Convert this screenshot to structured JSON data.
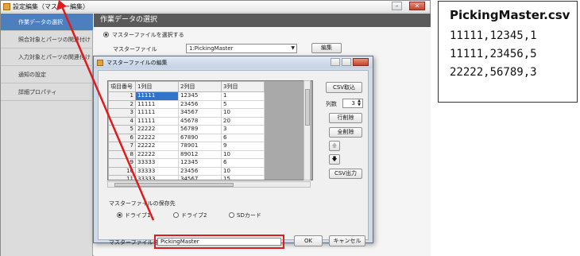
{
  "main_window": {
    "title": "設定編集（マスター編集）",
    "minimize": "–",
    "close": "✕"
  },
  "sidebar": {
    "items": [
      {
        "label": "作業データの選択"
      },
      {
        "label": "照合対象とパーツの関連付け"
      },
      {
        "label": "入力対象とパーツの関連付け"
      },
      {
        "label": "通知の設定"
      },
      {
        "label": "詳細プロパティ"
      }
    ]
  },
  "content": {
    "header": "作業データの選択",
    "master_radio_label": "マスターファイルを選択する",
    "master_file_label": "マスターファイル",
    "master_file_value": "1:PickingMaster",
    "edit_button": "編集"
  },
  "dialog": {
    "title": "マスターファイルの編集",
    "columns": [
      "項目番号",
      "1列目",
      "2列目",
      "3列目"
    ],
    "rows": [
      [
        "1",
        "11111",
        "12345",
        "1"
      ],
      [
        "2",
        "11111",
        "23456",
        "5"
      ],
      [
        "3",
        "11111",
        "34567",
        "10"
      ],
      [
        "4",
        "11111",
        "45678",
        "20"
      ],
      [
        "5",
        "22222",
        "56789",
        "3"
      ],
      [
        "6",
        "22222",
        "67890",
        "6"
      ],
      [
        "7",
        "22222",
        "78901",
        "9"
      ],
      [
        "8",
        "22222",
        "89012",
        "10"
      ],
      [
        "9",
        "33333",
        "12345",
        "6"
      ],
      [
        "10",
        "33333",
        "23456",
        "10"
      ],
      [
        "11",
        "33333",
        "34567",
        "15"
      ]
    ],
    "csv_import": "CSV取込",
    "column_count_label": "列数",
    "column_count_value": "3",
    "delete_row": "行削除",
    "delete_all": "全削除",
    "up_arrow": "🡅",
    "down_arrow": "🡇",
    "csv_export": "CSV出力",
    "save_location_label": "マスターファイルの保存先",
    "drive1": "ドライブ1",
    "drive2": "ドライブ2",
    "sdcard": "SDカード",
    "filename_label": "マスターファイル名",
    "filename_value": "PickingMaster",
    "ok": "OK",
    "cancel": "キャンセル"
  },
  "csv_panel": {
    "title": "PickingMaster.csv",
    "lines": [
      "11111,12345,1",
      "11111,23456,5",
      "22222,56789,3"
    ]
  },
  "colors": {
    "sidebar_selected": "#4d7fbf",
    "annotation_red": "#dd1d1d",
    "grid_selected": "#2f74c9"
  }
}
